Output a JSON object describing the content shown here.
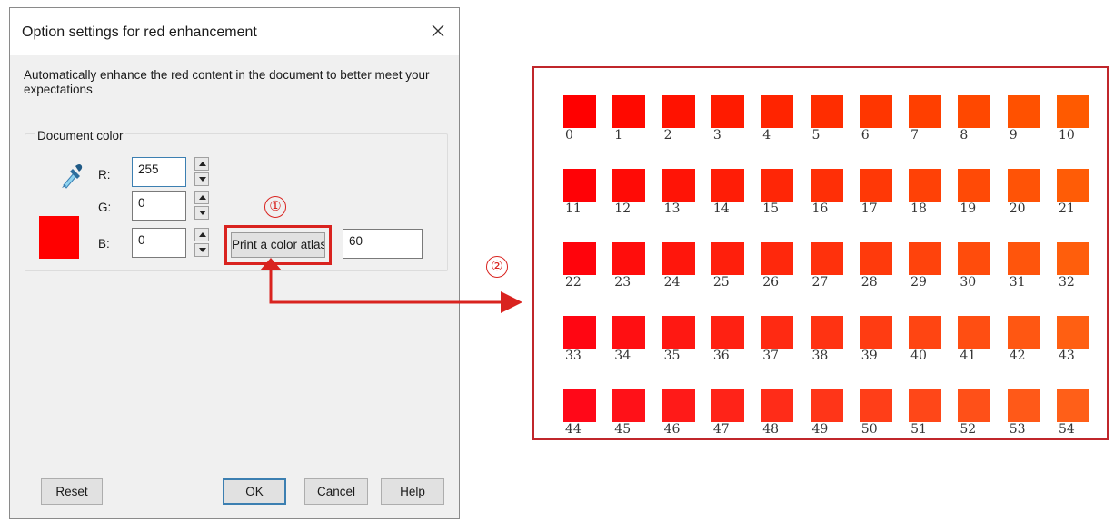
{
  "dialog": {
    "title": "Option settings for red enhancement",
    "description": "Automatically enhance the red content in the document to better meet your expectations",
    "group_label": "Document color",
    "color_hex": "#ff0000",
    "channels": [
      {
        "label": "R:",
        "value": "255"
      },
      {
        "label": "G:",
        "value": "0"
      },
      {
        "label": "B:",
        "value": "0"
      }
    ],
    "atlas_button": "Print a color atlas",
    "atlas_value": "60",
    "buttons": {
      "reset": "Reset",
      "ok": "OK",
      "cancel": "Cancel",
      "help": "Help"
    }
  },
  "annotations": {
    "step1": "①",
    "step2": "②",
    "highlight_color": "#d9231f"
  },
  "atlas": {
    "labels": [
      "0",
      "1",
      "2",
      "3",
      "4",
      "5",
      "6",
      "7",
      "8",
      "9",
      "10",
      "11",
      "12",
      "13",
      "14",
      "15",
      "16",
      "17",
      "18",
      "19",
      "20",
      "21",
      "22",
      "23",
      "24",
      "25",
      "26",
      "27",
      "28",
      "29",
      "30",
      "31",
      "32",
      "33",
      "34",
      "35",
      "36",
      "37",
      "38",
      "39",
      "40",
      "41",
      "42",
      "43",
      "44",
      "45",
      "46",
      "47",
      "48",
      "49",
      "50",
      "51",
      "52",
      "53",
      "54"
    ]
  }
}
